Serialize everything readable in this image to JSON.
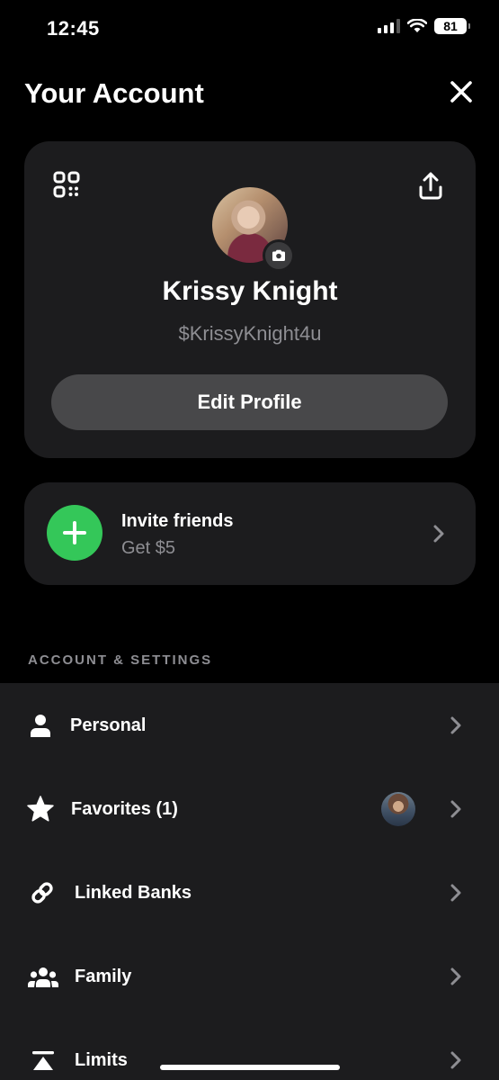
{
  "status_bar": {
    "time": "12:45",
    "battery": "81"
  },
  "header": {
    "title": "Your Account"
  },
  "profile": {
    "name": "Krissy Knight",
    "handle": "$KrissyKnight4u",
    "edit_label": "Edit Profile"
  },
  "invite": {
    "title": "Invite friends",
    "subtitle": "Get $5"
  },
  "section": {
    "label": "ACCOUNT & SETTINGS"
  },
  "settings": {
    "items": [
      {
        "label": "Personal",
        "icon": "person-icon"
      },
      {
        "label": "Favorites (1)",
        "icon": "star-icon"
      },
      {
        "label": "Linked Banks",
        "icon": "link-icon"
      },
      {
        "label": "Family",
        "icon": "family-icon"
      },
      {
        "label": "Limits",
        "icon": "limits-icon"
      }
    ]
  },
  "colors": {
    "background": "#000000",
    "card": "#1c1c1e",
    "accent_green": "#34c759",
    "muted_text": "#8e8e93",
    "button": "#48484a"
  }
}
